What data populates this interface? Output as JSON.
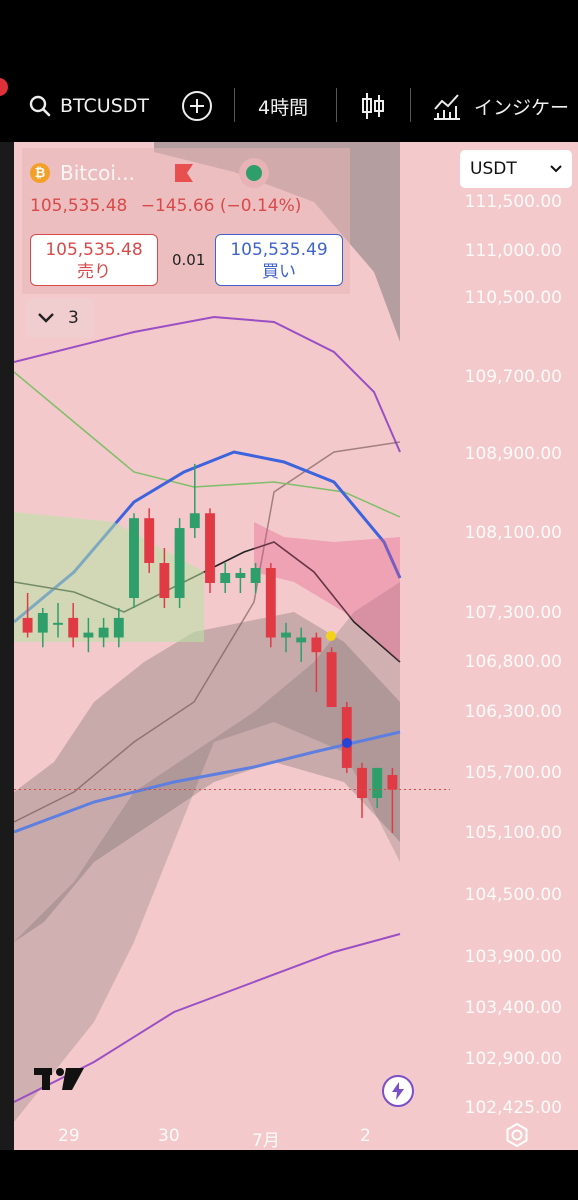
{
  "toolbar": {
    "symbol": "BTCUSDT",
    "interval": "4時間",
    "indicators_label": "インジケー"
  },
  "legend": {
    "symbol_short": "Bitcoi...",
    "coin_glyph": "₿",
    "last_price": "105,535.48",
    "change": "−145.66 (−0.14%)",
    "sell_price": "105,535.48",
    "sell_label": "売り",
    "buy_price": "105,535.49",
    "buy_label": "買い",
    "spread": "0.01",
    "collapsed_count": "3"
  },
  "currency": "USDT",
  "colors": {
    "bg": "#f3c9cb",
    "bull": "#2e9e6b",
    "bear": "#e03a45",
    "ma_blue": "#3d63dd",
    "band_purple": "#9b4fc4",
    "ma_green": "#7fbf6a",
    "kumo_dark": "#6b6b6b"
  },
  "chart_data": {
    "type": "candlestick",
    "symbol": "BTCUSDT",
    "interval": "4時間",
    "ylim": [
      102425,
      111500
    ],
    "y_ticks": [
      "111,500.00",
      "111,000.00",
      "110,500.00",
      "109,700.00",
      "108,900.00",
      "108,100.00",
      "107,300.00",
      "106,800.00",
      "106,300.00",
      "105,700.00",
      "105,100.00",
      "104,500.00",
      "103,900.00",
      "103,400.00",
      "102,900.00",
      "102,425.00"
    ],
    "x_ticks": [
      "29",
      "30",
      "7月",
      "2"
    ],
    "candles": [
      {
        "o": 107250,
        "h": 107500,
        "l": 107050,
        "c": 107100
      },
      {
        "o": 107100,
        "h": 107350,
        "l": 106950,
        "c": 107300
      },
      {
        "o": 107200,
        "h": 107400,
        "l": 107050,
        "c": 107200
      },
      {
        "o": 107250,
        "h": 107400,
        "l": 106950,
        "c": 107050
      },
      {
        "o": 107050,
        "h": 107250,
        "l": 106900,
        "c": 107100
      },
      {
        "o": 107050,
        "h": 107250,
        "l": 106950,
        "c": 107150
      },
      {
        "o": 107050,
        "h": 107350,
        "l": 106950,
        "c": 107250
      },
      {
        "o": 107450,
        "h": 108300,
        "l": 107350,
        "c": 108250
      },
      {
        "o": 108250,
        "h": 108350,
        "l": 107700,
        "c": 107800
      },
      {
        "o": 107800,
        "h": 107950,
        "l": 107350,
        "c": 107450
      },
      {
        "o": 107450,
        "h": 108250,
        "l": 107350,
        "c": 108150
      },
      {
        "o": 108150,
        "h": 108800,
        "l": 108050,
        "c": 108300
      },
      {
        "o": 108300,
        "h": 108350,
        "l": 107500,
        "c": 107600
      },
      {
        "o": 107600,
        "h": 107800,
        "l": 107500,
        "c": 107700
      },
      {
        "o": 107650,
        "h": 107750,
        "l": 107500,
        "c": 107700
      },
      {
        "o": 107600,
        "h": 107800,
        "l": 107500,
        "c": 107750
      },
      {
        "o": 107750,
        "h": 107800,
        "l": 106950,
        "c": 107050
      },
      {
        "o": 107050,
        "h": 107200,
        "l": 106900,
        "c": 107100
      },
      {
        "o": 107000,
        "h": 107150,
        "l": 106800,
        "c": 107050
      },
      {
        "o": 107050,
        "h": 107100,
        "l": 106500,
        "c": 106900
      },
      {
        "o": 106900,
        "h": 106950,
        "l": 106350,
        "c": 106350
      },
      {
        "o": 106350,
        "h": 106400,
        "l": 105700,
        "c": 105750
      },
      {
        "o": 105750,
        "h": 105800,
        "l": 105250,
        "c": 105450
      },
      {
        "o": 105450,
        "h": 105750,
        "l": 105350,
        "c": 105750
      },
      {
        "o": 105680,
        "h": 105750,
        "l": 105100,
        "c": 105535
      }
    ],
    "last_price": 105535.48
  }
}
